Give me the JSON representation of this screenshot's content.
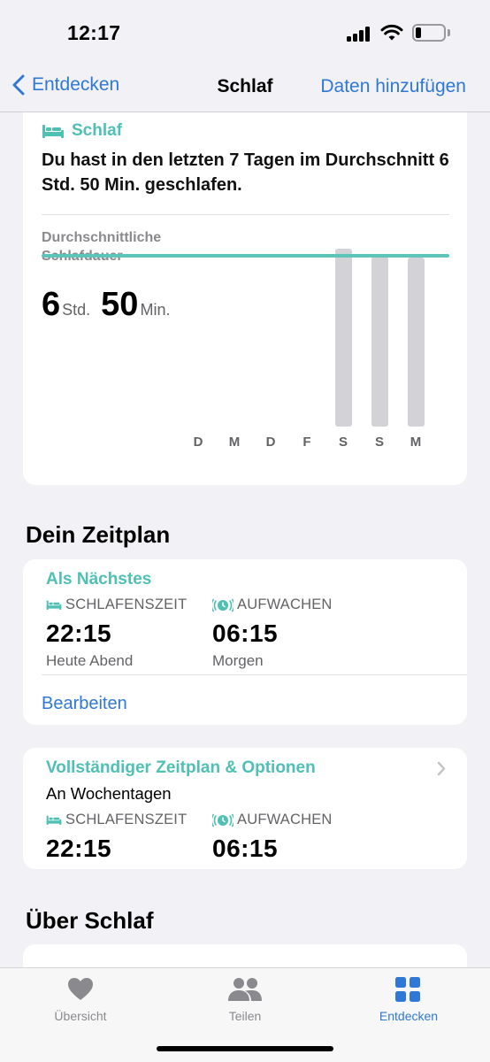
{
  "status": {
    "time": "12:17"
  },
  "nav": {
    "back_label": "Entdecken",
    "title": "Schlaf",
    "action_label": "Daten hinzufügen"
  },
  "sleep_card": {
    "header": "Schlaf",
    "summary": "Du hast in den letzten 7 Tagen im Durchschnitt 6 Std. 50 Min. geschlafen.",
    "avg_label": "Durchschnittliche Schlafdauer",
    "avg_hours": "6",
    "hours_unit": "Std.",
    "avg_minutes": "50",
    "minutes_unit": "Min.",
    "chart_data": {
      "type": "bar",
      "categories": [
        "D",
        "M",
        "D",
        "F",
        "S",
        "S",
        "M"
      ],
      "values": [
        null,
        null,
        null,
        null,
        7.1,
        6.8,
        6.75
      ],
      "average_hours": 6.833,
      "colors": {
        "bar": "#d2d2d7",
        "average_line": "#5cc5b9"
      }
    }
  },
  "schedule": {
    "section_title": "Dein Zeitplan",
    "next": {
      "title": "Als Nächstes",
      "bedtime_label": "SCHLAFENSZEIT",
      "bedtime": "22:15",
      "bedtime_sub": "Heute Abend",
      "wake_label": "AUFWACHEN",
      "wake": "06:15",
      "wake_sub": "Morgen",
      "edit_label": "Bearbeiten"
    },
    "full": {
      "title": "Vollständiger Zeitplan & Optionen",
      "days": "An Wochentagen",
      "bedtime_label": "SCHLAFENSZEIT",
      "bedtime": "22:15",
      "wake_label": "AUFWACHEN",
      "wake": "06:15"
    }
  },
  "about": {
    "section_title": "Über Schlaf"
  },
  "tabs": [
    {
      "label": "Übersicht",
      "icon": "heart-icon"
    },
    {
      "label": "Teilen",
      "icon": "people-icon"
    },
    {
      "label": "Entdecken",
      "icon": "grid-icon",
      "active": true
    }
  ],
  "colors": {
    "accent": "#2f78d6",
    "sleep": "#4fc0b3",
    "alarm": "#4fc0b3"
  }
}
